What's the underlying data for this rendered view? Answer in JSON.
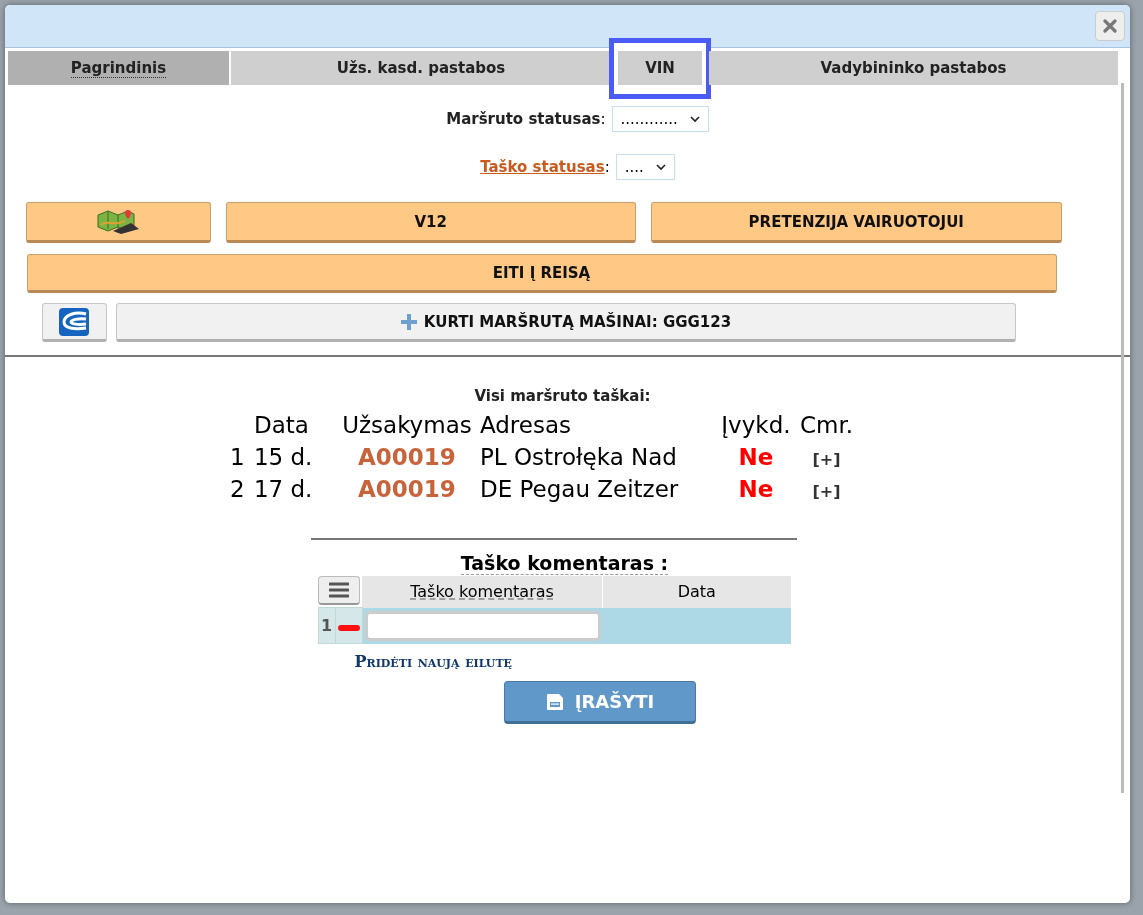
{
  "tabs": [
    {
      "label": "Pagrindinis",
      "selected": true,
      "highlighted": false
    },
    {
      "label": "Užs. kasd. pastabos",
      "selected": false,
      "highlighted": false
    },
    {
      "label": "VIN",
      "selected": false,
      "highlighted": true
    },
    {
      "label": "Vadybininko pastabos",
      "selected": false,
      "highlighted": false
    }
  ],
  "route_status": {
    "label": "Maršruto statusas",
    "separator": ":",
    "value": "............"
  },
  "point_status": {
    "label": "Taško statusas",
    "separator": ":",
    "value": "...."
  },
  "action_buttons": [
    {
      "kind": "map"
    },
    {
      "kind": "text",
      "label": "V12"
    },
    {
      "kind": "text",
      "label": "PRETENZIJA VAIRUOTOJUI"
    }
  ],
  "go_button": {
    "label": "EITI Į REISĄ"
  },
  "create_route": {
    "label": "KURTI MARŠRUTĄ MAŠINAI: GGG123"
  },
  "points": {
    "title": "Visi maršruto taškai:",
    "columns": [
      "Data",
      "Užsakymas",
      "Adresas",
      "Įvykd.",
      "Cmr."
    ],
    "rows": [
      {
        "number": "1",
        "date": "15 d.",
        "order": "A00019",
        "address": "PL Ostrołęka Nad",
        "done": "Ne",
        "cmr": "[+]"
      },
      {
        "number": "2",
        "date": "17 d.",
        "order": "A00019",
        "address": "DE Pegau Zeitzer",
        "done": "Ne",
        "cmr": "[+]"
      }
    ]
  },
  "comments": {
    "title": "Taško komentaras :",
    "columns": [
      "Taško komentaras",
      "Data"
    ],
    "rows": [
      {
        "number": "1"
      }
    ],
    "add_link": "Pridėti naują eilutę",
    "save_button": "ĮRAŠYTI"
  }
}
